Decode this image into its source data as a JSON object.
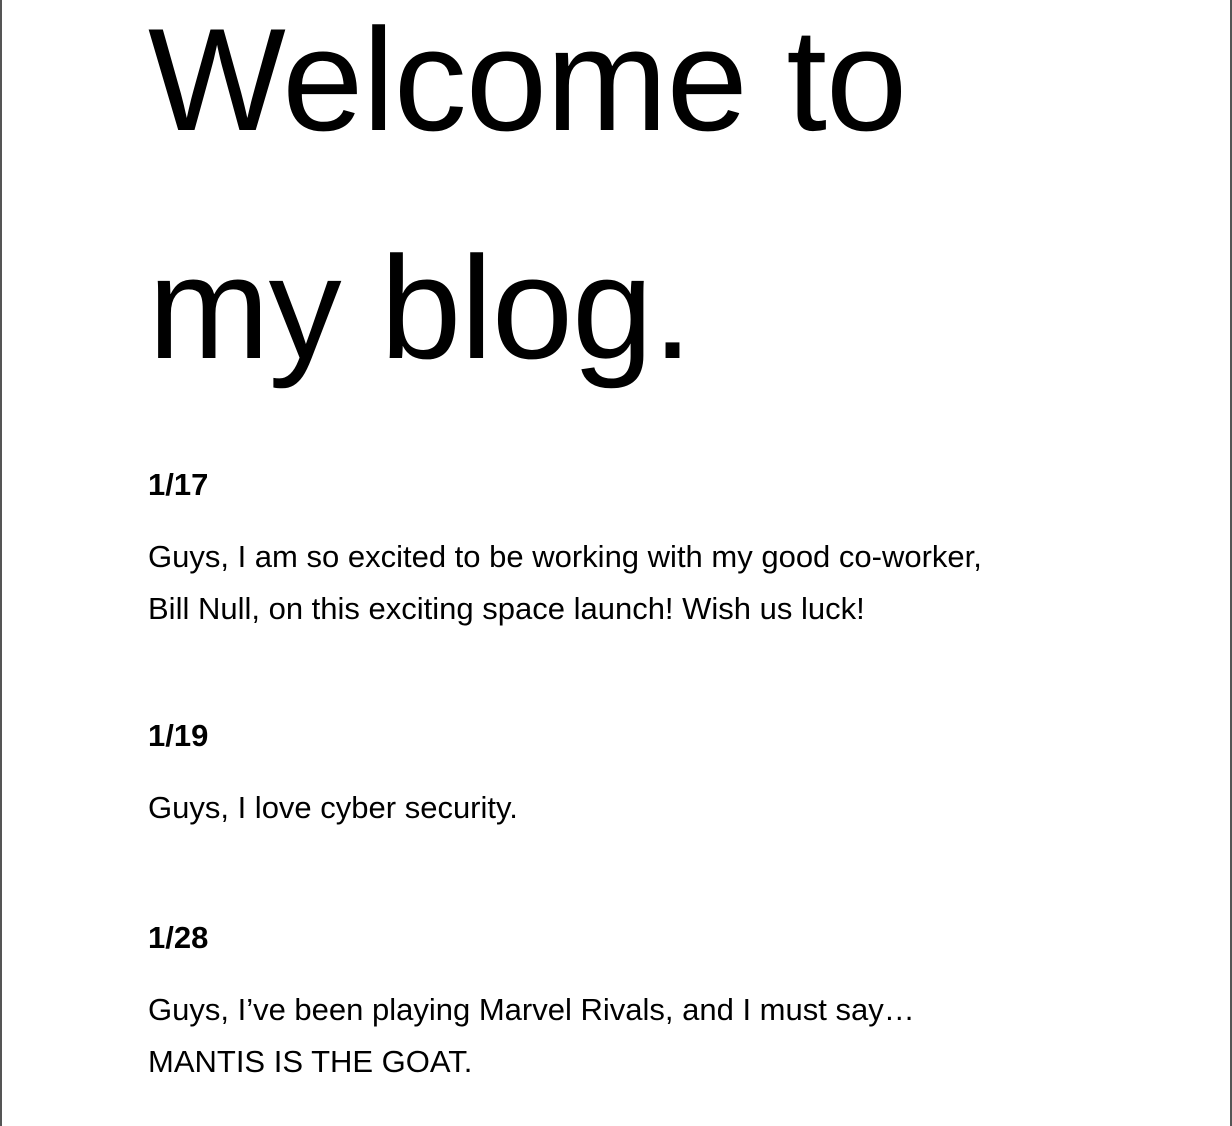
{
  "title": {
    "line1": "Welcome to",
    "line2": "my blog."
  },
  "posts": [
    {
      "date": "1/17",
      "lines": [
        "Guys, I am so excited to be working with my good co-worker,",
        "Bill Null, on this exciting space launch! Wish us luck!"
      ]
    },
    {
      "date": "1/19",
      "lines": [
        "Guys, I love cyber security."
      ]
    },
    {
      "date": "1/28",
      "lines": [
        "Guys, I’ve been playing Marvel Rivals, and I must say…",
        "MANTIS IS THE GOAT."
      ]
    }
  ]
}
